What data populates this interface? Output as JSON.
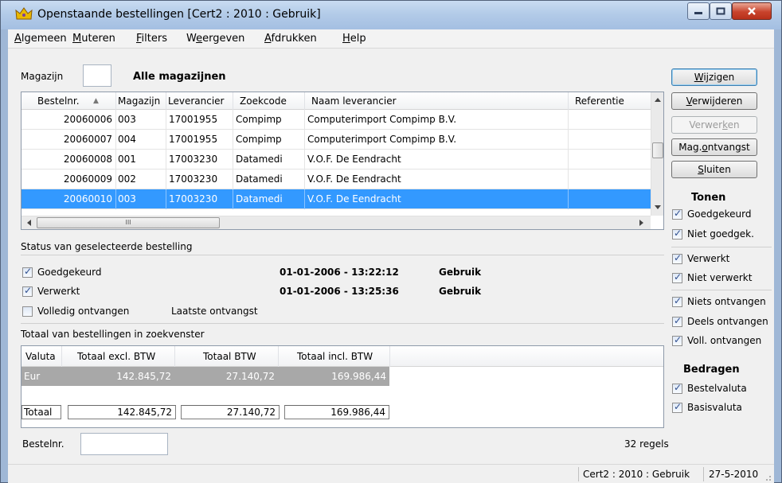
{
  "window": {
    "title": "Openstaande bestellingen  [Cert2 : 2010 : Gebruik]"
  },
  "menu": [
    {
      "pre": "",
      "u": "A",
      "post": "lgemeen"
    },
    {
      "pre": "",
      "u": "M",
      "post": "uteren"
    },
    {
      "pre": "",
      "u": "F",
      "post": "ilters"
    },
    {
      "pre": "W",
      "u": "e",
      "post": "ergeven"
    },
    {
      "pre": "",
      "u": "A",
      "post": "fdrukken"
    },
    {
      "pre": "",
      "u": "H",
      "post": "elp"
    }
  ],
  "magazijn": {
    "label": "Magazijn",
    "value": "",
    "name": "Alle magazijnen"
  },
  "grid": {
    "columns": [
      "Bestelnr.",
      "Magazijn",
      "Leverancier",
      "Zoekcode",
      "Naam leverancier",
      "Referentie"
    ],
    "sort_indicator": "▲",
    "rows": [
      [
        "20060006",
        "003",
        "17001955",
        "Compimp",
        "Computerimport Compimp B.V.",
        ""
      ],
      [
        "20060007",
        "004",
        "17001955",
        "Compimp",
        "Computerimport Compimp B.V.",
        ""
      ],
      [
        "20060008",
        "001",
        "17003230",
        "Datamedi",
        "V.O.F. De Eendracht",
        ""
      ],
      [
        "20060009",
        "002",
        "17003230",
        "Datamedi",
        "V.O.F. De Eendracht",
        ""
      ],
      [
        "20060010",
        "003",
        "17003230",
        "Datamedi",
        "V.O.F. De Eendracht",
        ""
      ]
    ],
    "hscroll_grip": "III"
  },
  "buttons": [
    {
      "pre": "",
      "u": "W",
      "post": "ijzigen"
    },
    {
      "pre": "",
      "u": "V",
      "post": "erwijderen"
    },
    {
      "pre": "Verwer",
      "u": "k",
      "post": "en"
    },
    {
      "pre": "Mag.",
      "u": "o",
      "post": "ntvangst"
    },
    {
      "pre": "",
      "u": "S",
      "post": "luiten"
    }
  ],
  "tonen": {
    "heading": "Tonen",
    "items": [
      "Goedgekeurd",
      "Niet goedgek.",
      "Verwerkt",
      "Niet verwerkt",
      "Niets ontvangen",
      "Deels ontvangen",
      "Voll. ontvangen"
    ]
  },
  "bedragen": {
    "heading": "Bedragen",
    "items": [
      "Bestelvaluta",
      "Basisvaluta"
    ]
  },
  "status": {
    "heading": "Status van geselecteerde bestelling",
    "goedgekeurd": {
      "label": "Goedgekeurd",
      "date": "01-01-2006 - 13:22:12",
      "user": "Gebruik"
    },
    "verwerkt": {
      "label": "Verwerkt",
      "date": "01-01-2006 - 13:25:36",
      "user": "Gebruik"
    },
    "volledig": {
      "label": "Volledig ontvangen",
      "laatste": "Laatste ontvangst"
    }
  },
  "totaal": {
    "heading": "Totaal van bestellingen in zoekvenster",
    "columns": [
      "Valuta",
      "Totaal excl. BTW",
      "Totaal BTW",
      "Totaal incl. BTW"
    ],
    "row": [
      "Eur",
      "142.845,72",
      "27.140,72",
      "169.986,44"
    ],
    "total_label": "Totaal",
    "totals": [
      "142.845,72",
      "27.140,72",
      "169.986,44"
    ]
  },
  "footer": {
    "bestelnr_label": "Bestelnr.",
    "bestelnr_value": "",
    "regels": "32 regels"
  },
  "statusbar": {
    "context": "Cert2 : 2010 : Gebruik",
    "date": "27-5-2010"
  }
}
